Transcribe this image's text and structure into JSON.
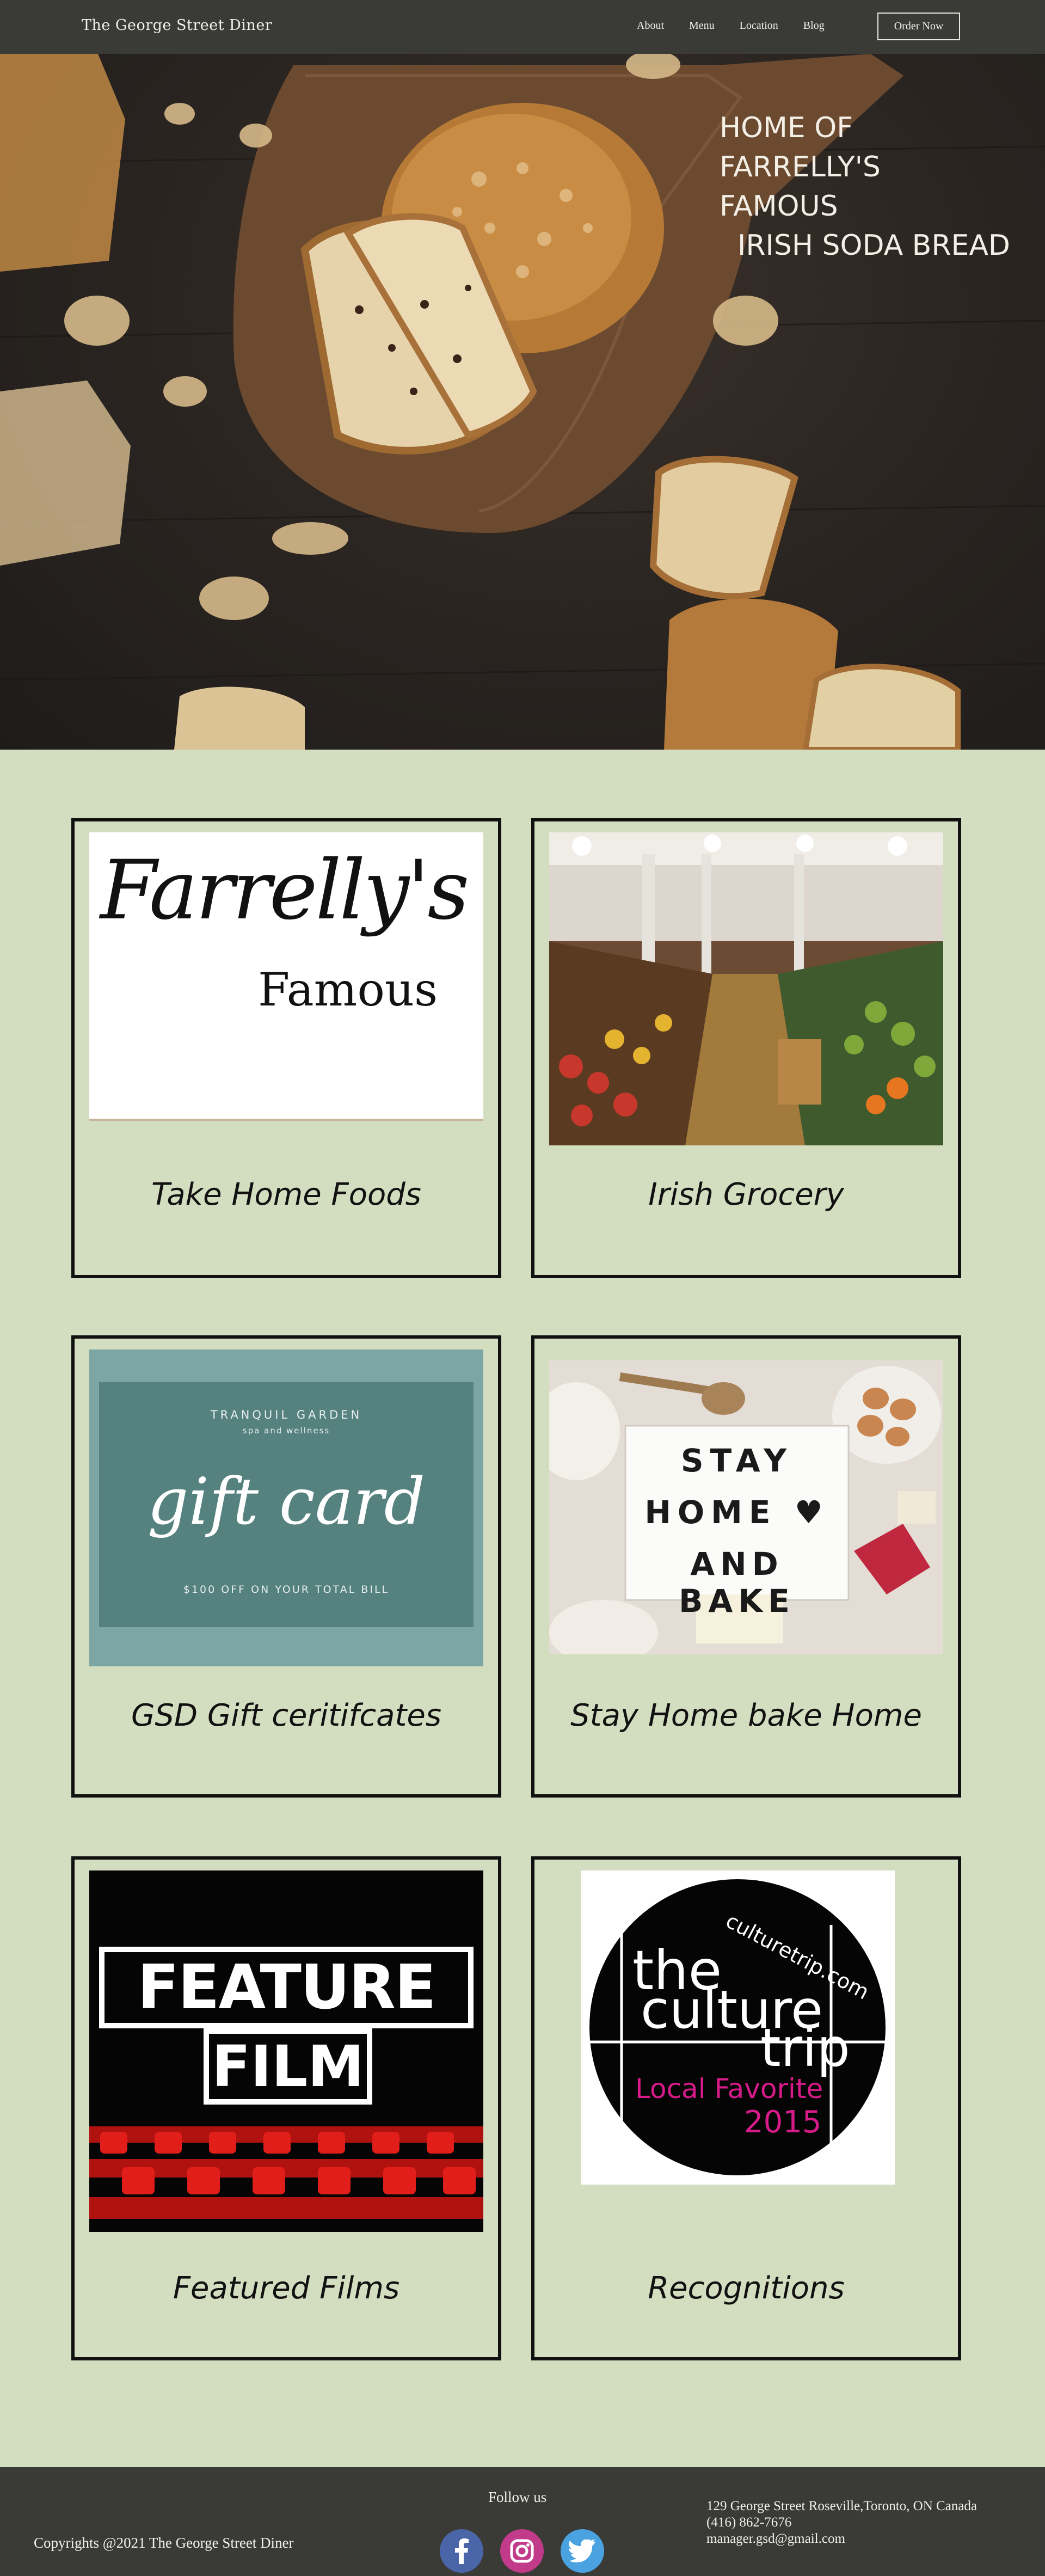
{
  "header": {
    "brand": "The George Street Diner",
    "nav": [
      "About",
      "Menu",
      "Location",
      "Blog"
    ],
    "order_button": "Order Now"
  },
  "hero": {
    "title_lines": [
      "HOME OF",
      "FARRELLY'S",
      "FAMOUS",
      "  IRISH SODA BREAD"
    ]
  },
  "cards": [
    {
      "label": "Take Home Foods",
      "image": "farrellys-famous-logo",
      "image_text_1": "Farrelly's",
      "image_text_2": "Famous"
    },
    {
      "label": "Irish Grocery",
      "image": "grocery-store-photo"
    },
    {
      "label": "GSD Gift ceritifcates",
      "image": "gift-card",
      "image_text_1": "TRANQUIL GARDEN",
      "image_text_2": "spa and wellness",
      "image_text_3": "gift card",
      "image_text_4": "$100 OFF ON YOUR TOTAL BILL"
    },
    {
      "label": "Stay Home bake Home",
      "image": "stay-home-and-bake-photo",
      "image_text_1": "STAY",
      "image_text_2": "HOME ♥",
      "image_text_3": "AND BAKE"
    },
    {
      "label": "Featured Films",
      "image": "feature-film-poster",
      "image_text_1": "FEATURE",
      "image_text_2": "FILM"
    },
    {
      "label": "Recognitions",
      "image": "culture-trip-badge",
      "image_text_1": "culturetrip.com",
      "image_text_2": "the",
      "image_text_3": "culture",
      "image_text_4": "trip",
      "image_text_5": "Local Favorite",
      "image_text_6": "2015"
    }
  ],
  "footer": {
    "copyright": "Copyrights @2021 The George Street Diner",
    "follow_label": "Follow us",
    "social": [
      "facebook-icon",
      "instagram-icon",
      "twitter-icon"
    ],
    "address": "129 George Street Roseville,Toronto, ON Canada",
    "phone": "(416) 862-7676",
    "email": "manager.gsd@gmail.com"
  },
  "colors": {
    "header_bg": "#3a3a37",
    "page_bg": "#d3ddbf",
    "card_border": "#111111",
    "facebook": "#4a66a8",
    "instagram": "#c23a8a",
    "twitter": "#4aa3e0"
  }
}
